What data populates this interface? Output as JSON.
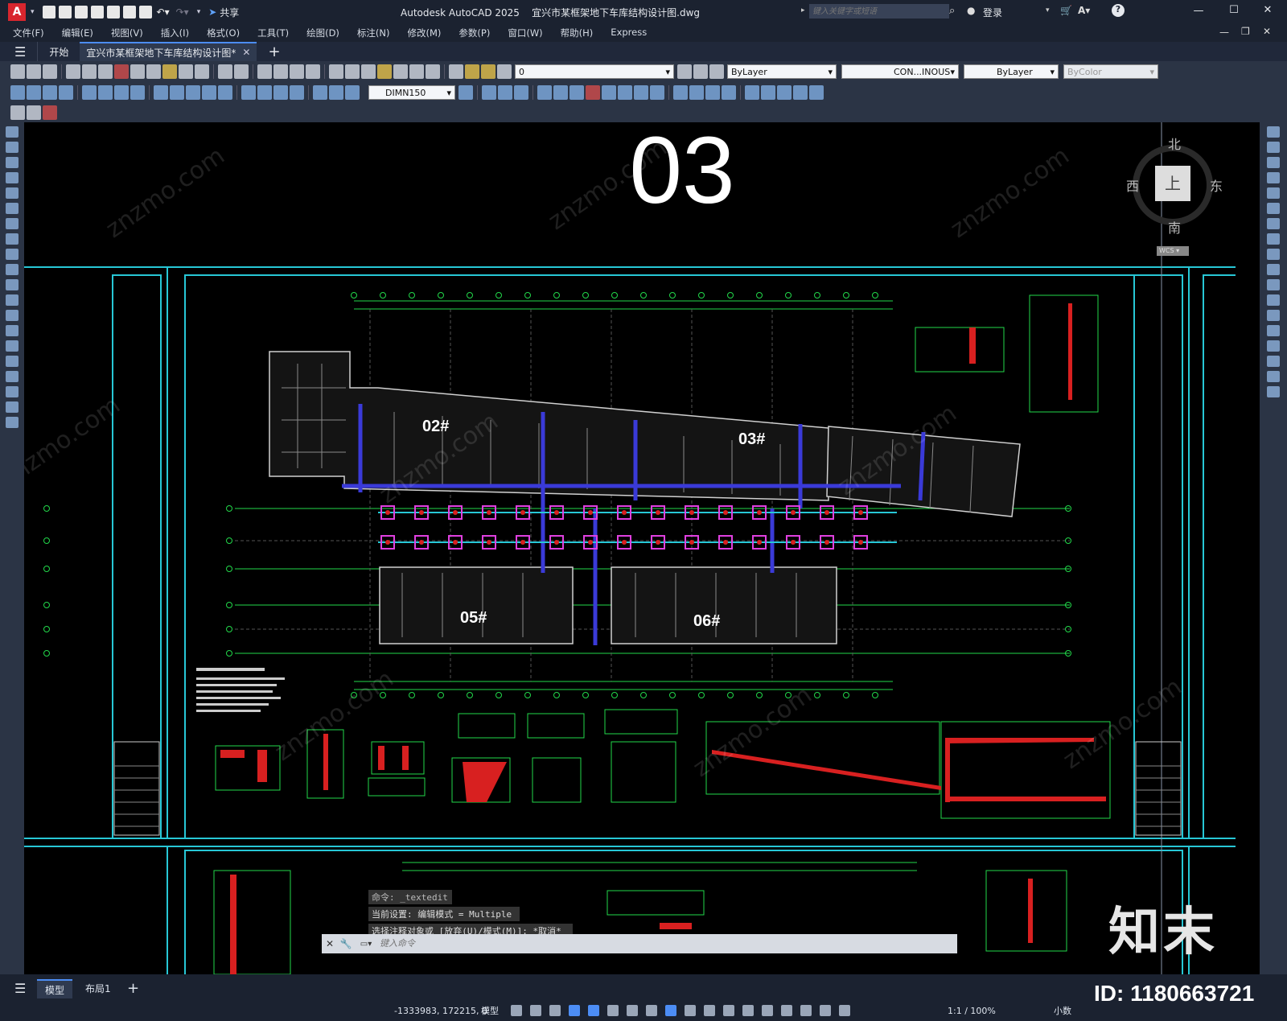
{
  "titlebar": {
    "app_logo": "A",
    "share_label": "共享",
    "title": "Autodesk AutoCAD 2025    宜兴市某框架地下车库结构设计图.dwg",
    "search_placeholder": "键入关键字或短语",
    "login_label": "登录"
  },
  "menubar": {
    "items": [
      "文件(F)",
      "编辑(E)",
      "视图(V)",
      "插入(I)",
      "格式(O)",
      "工具(T)",
      "绘图(D)",
      "标注(N)",
      "修改(M)",
      "参数(P)",
      "窗口(W)",
      "帮助(H)",
      "Express"
    ]
  },
  "tabs": {
    "start": "开始",
    "active": "宜兴市某框架地下车库结构设计图*"
  },
  "toolbar": {
    "layer_value": "0",
    "color_value": "ByLayer",
    "linetype_value": "CON...INOUS",
    "lineweight_value": "ByLayer",
    "plotstyle_value": "ByColor",
    "dimstyle_value": "DIMN150"
  },
  "viewcube": {
    "north": "北",
    "south": "南",
    "east": "东",
    "west": "西",
    "face": "上",
    "wcs": "WCS"
  },
  "drawing": {
    "sheet_number": "03",
    "buildings": [
      "02#",
      "03#",
      "05#",
      "06#"
    ],
    "colors": {
      "grid": "#22d84a",
      "frame": "#27c7d6",
      "building": "#d0d0d0",
      "column": "#e040e0",
      "beam": "#3a3ad8",
      "section": "#d82020"
    }
  },
  "command": {
    "line1": "命令: _textedit",
    "line2": "当前设置: 编辑模式 = Multiple",
    "line3": "选择注释对象或 [放弃(U)/模式(M)]: *取消*",
    "input_placeholder": "键入命令"
  },
  "status": {
    "tab_model": "模型",
    "tab_layout": "布局1",
    "add_tab": "+",
    "coords": "-1333983, 172215, 0",
    "model_label": "模型",
    "scale": "1:1 / 100%",
    "units": "小数"
  },
  "brand": {
    "logo_text": "知末",
    "id_text": "ID: 1180663721",
    "watermark": "znzmo.com"
  }
}
